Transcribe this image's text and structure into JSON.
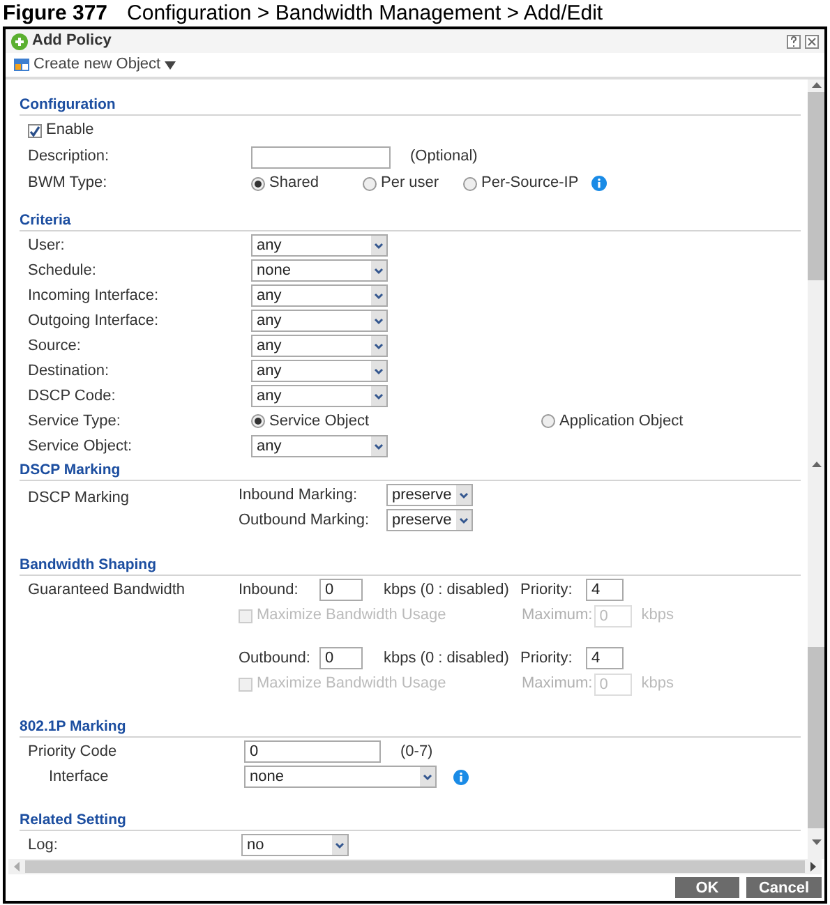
{
  "figure_caption": {
    "number": "Figure 377",
    "title": "Configuration > Bandwidth Management > Add/Edit"
  },
  "dialog": {
    "title": "Add Policy",
    "toolbar_label": "Create new Object",
    "sections": [
      {
        "title": "Configuration",
        "rows": [
          {
            "kind": "checkbox",
            "label": "Enable",
            "checked": true
          },
          {
            "kind": "text",
            "label": "Description:",
            "note": "(Optional)"
          },
          {
            "kind": "radio",
            "label": "BWM Type:",
            "info_icon": true,
            "options": [
              {
                "label": "Shared",
                "selected": true
              },
              {
                "label": "Per user",
                "selected": false
              },
              {
                "label": "Per-Source-IP",
                "selected": false
              }
            ]
          }
        ]
      },
      {
        "title": "Criteria",
        "rows": [
          {
            "kind": "select",
            "label": "User:",
            "value": "any"
          },
          {
            "kind": "select",
            "label": "Schedule:",
            "value": "none"
          },
          {
            "kind": "select",
            "label": "Incoming Interface:",
            "value": "any"
          },
          {
            "kind": "select",
            "label": "Outgoing Interface:",
            "value": "any"
          },
          {
            "kind": "select",
            "label": "Source:",
            "value": "any"
          },
          {
            "kind": "select",
            "label": "Destination:",
            "value": "any"
          },
          {
            "kind": "select",
            "label": "DSCP Code:",
            "value": "any"
          },
          {
            "kind": "radio",
            "label": "Service Type:",
            "options": [
              {
                "label": "Service Object",
                "selected": true
              },
              {
                "label": "Application Object",
                "selected": false
              }
            ]
          },
          {
            "kind": "select",
            "label": "Service Object:",
            "value": "any"
          }
        ]
      },
      {
        "title": "DSCP Marking",
        "rows": [
          {
            "kind": "marking",
            "label": "DSCP Marking",
            "fields": [
              {
                "label": "Inbound Marking:",
                "value": "preserve"
              },
              {
                "label": "Outbound Marking:",
                "value": "preserve"
              }
            ]
          }
        ]
      },
      {
        "title": "Bandwidth Shaping",
        "rows": [
          {
            "kind": "bandwidth",
            "label": "Guaranteed Bandwidth",
            "directions": [
              {
                "label": "Inbound:",
                "value": "0",
                "unit": "kbps (0 : disabled)",
                "priority_label": "Priority:",
                "priority": "4",
                "maximize": {
                  "label": "Maximize Bandwidth Usage",
                  "checked": false,
                  "disabled": true
                },
                "maximum_label": "Maximum:",
                "maximum": "0",
                "maximum_unit": "kbps"
              },
              {
                "label": "Outbound:",
                "value": "0",
                "unit": "kbps (0 : disabled)",
                "priority_label": "Priority:",
                "priority": "4",
                "maximize": {
                  "label": "Maximize Bandwidth Usage",
                  "checked": false,
                  "disabled": true
                },
                "maximum_label": "Maximum:",
                "maximum": "0",
                "maximum_unit": "kbps"
              }
            ]
          }
        ]
      },
      {
        "title": "802.1P Marking",
        "rows": [
          {
            "kind": "text",
            "label": "Priority Code",
            "value": "0",
            "note": "(0-7)"
          },
          {
            "kind": "select",
            "label": "Interface",
            "value": "none",
            "indented": true,
            "info_icon": true
          }
        ]
      },
      {
        "title": "Related Setting",
        "rows": [
          {
            "kind": "select",
            "label": "Log:",
            "value": "no"
          }
        ]
      }
    ],
    "buttons": [
      "OK",
      "Cancel"
    ]
  }
}
